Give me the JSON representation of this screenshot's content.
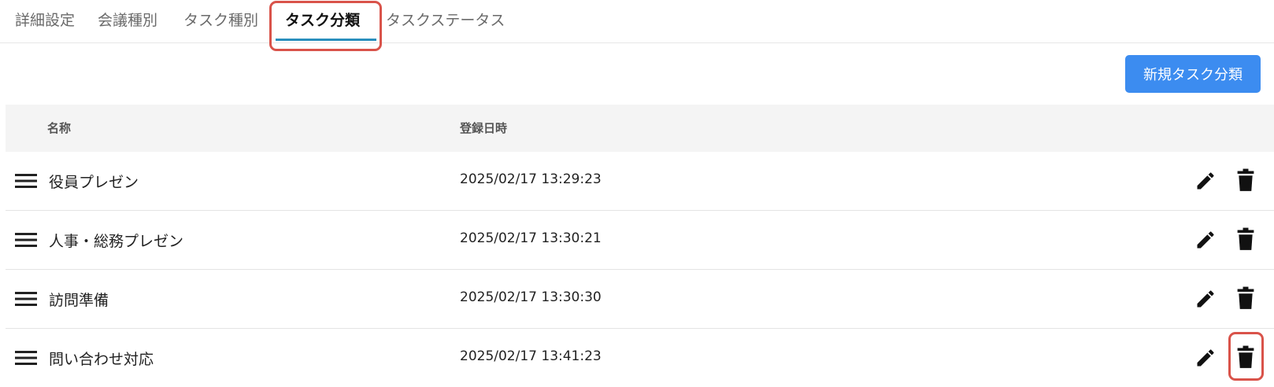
{
  "tabs": [
    {
      "label": "詳細設定",
      "active": false
    },
    {
      "label": "会議種別",
      "active": false
    },
    {
      "label": "タスク種別",
      "active": false
    },
    {
      "label": "タスク分類",
      "active": true
    },
    {
      "label": "タスクステータス",
      "active": false
    }
  ],
  "toolbar": {
    "new_button_label": "新規タスク分類"
  },
  "table": {
    "headers": {
      "name": "名称",
      "registered_at": "登録日時"
    },
    "rows": [
      {
        "name": "役員プレゼン",
        "registered_at": "2025/02/17 13:29:23"
      },
      {
        "name": "人事・総務プレゼン",
        "registered_at": "2025/02/17 13:30:21"
      },
      {
        "name": "訪問準備",
        "registered_at": "2025/02/17 13:30:30"
      },
      {
        "name": "問い合わせ対応",
        "registered_at": "2025/02/17 13:41:23"
      }
    ]
  },
  "icons": {
    "drag": "drag-handle-icon",
    "edit": "pencil-icon",
    "delete": "trash-icon"
  },
  "colors": {
    "accent": "#3c8cf0",
    "tab_underline": "#2a8fbd",
    "highlight": "#d9534a",
    "header_bg": "#f4f4f4"
  }
}
